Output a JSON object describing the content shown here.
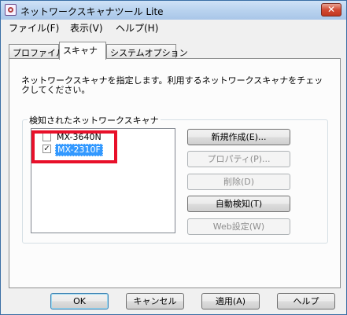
{
  "window": {
    "title": "ネットワークスキャナツール Lite",
    "close_label": "✕"
  },
  "menu": [
    "ファイル(F)",
    "表示(V)",
    "ヘルプ(H)"
  ],
  "tabs": [
    "プロファイル",
    "スキャナ",
    "システムオプション"
  ],
  "active_tab": "スキャナ",
  "description": "ネットワークスキャナを指定します。利用するネットワークスキャナをチェックしてください。",
  "group_title": "検知されたネットワークスキャナ",
  "scanners": [
    {
      "name": "MX-3640N",
      "checked": false,
      "selected": false
    },
    {
      "name": "MX-2310F",
      "checked": true,
      "selected": true
    }
  ],
  "check_mark": "✓",
  "side_buttons": [
    {
      "label": "新規作成(E)...",
      "enabled": true
    },
    {
      "label": "プロパティ(P)...",
      "enabled": false
    },
    {
      "label": "削除(D)",
      "enabled": false
    },
    {
      "label": "自動検知(T)",
      "enabled": true
    },
    {
      "label": "Web設定(W)",
      "enabled": false
    }
  ],
  "bottom_buttons": [
    "OK",
    "キャンセル",
    "適用(A)",
    "ヘルプ"
  ],
  "colors": {
    "highlight": "#e8102a",
    "selection": "#3399ff"
  }
}
